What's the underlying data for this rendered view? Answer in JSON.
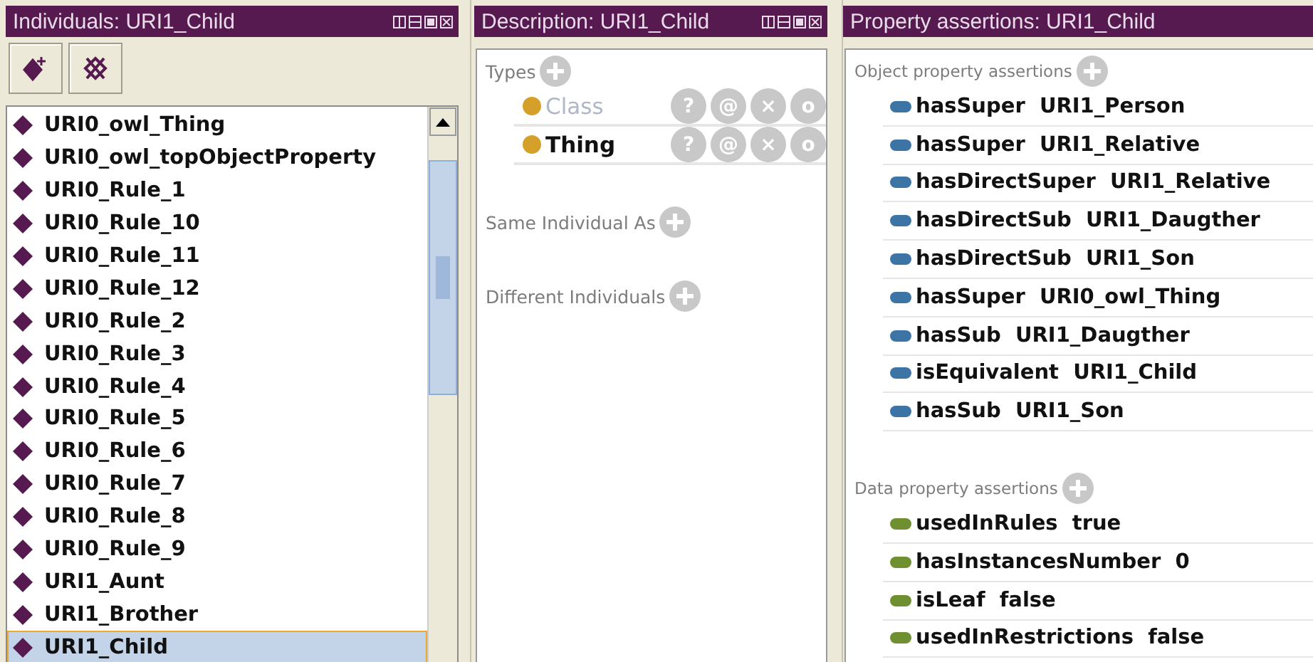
{
  "individuals_panel": {
    "title": "Individuals: URI1_Child",
    "items": [
      {
        "label": "URI0_owl_Thing",
        "selected": false
      },
      {
        "label": "URI0_owl_topObjectProperty",
        "selected": false
      },
      {
        "label": "URI0_Rule_1",
        "selected": false
      },
      {
        "label": "URI0_Rule_10",
        "selected": false
      },
      {
        "label": "URI0_Rule_11",
        "selected": false
      },
      {
        "label": "URI0_Rule_12",
        "selected": false
      },
      {
        "label": "URI0_Rule_2",
        "selected": false
      },
      {
        "label": "URI0_Rule_3",
        "selected": false
      },
      {
        "label": "URI0_Rule_4",
        "selected": false
      },
      {
        "label": "URI0_Rule_5",
        "selected": false
      },
      {
        "label": "URI0_Rule_6",
        "selected": false
      },
      {
        "label": "URI0_Rule_7",
        "selected": false
      },
      {
        "label": "URI0_Rule_8",
        "selected": false
      },
      {
        "label": "URI0_Rule_9",
        "selected": false
      },
      {
        "label": "URI1_Aunt",
        "selected": false
      },
      {
        "label": "URI1_Brother",
        "selected": false
      },
      {
        "label": "URI1_Child",
        "selected": true
      }
    ]
  },
  "description_panel": {
    "title": "Description: URI1_Child",
    "sections": [
      {
        "heading": "Types",
        "items": [
          {
            "label": "Class",
            "disabled": true,
            "actions": [
              "?",
              "@",
              "×",
              "o"
            ]
          },
          {
            "label": "Thing",
            "disabled": false,
            "actions": [
              "?",
              "@",
              "×",
              "o"
            ]
          }
        ]
      },
      {
        "heading": "Same Individual As"
      },
      {
        "heading": "Different Individuals"
      }
    ]
  },
  "property_panel": {
    "title": "Property assertions: URI1_Child",
    "sections": [
      {
        "heading": "Object property assertions",
        "kind": "object",
        "items": [
          {
            "property": "hasSuper",
            "value": "URI1_Person"
          },
          {
            "property": "hasSuper",
            "value": "URI1_Relative"
          },
          {
            "property": "hasDirectSuper",
            "value": "URI1_Relative"
          },
          {
            "property": "hasDirectSub",
            "value": "URI1_Daugther"
          },
          {
            "property": "hasDirectSub",
            "value": "URI1_Son"
          },
          {
            "property": "hasSuper",
            "value": "URI0_owl_Thing"
          },
          {
            "property": "hasSub",
            "value": "URI1_Daugther"
          },
          {
            "property": "isEquivalent",
            "value": "URI1_Child"
          },
          {
            "property": "hasSub",
            "value": "URI1_Son"
          }
        ]
      },
      {
        "heading": "Data property assertions",
        "kind": "data",
        "items": [
          {
            "property": "usedInRules",
            "value": "true"
          },
          {
            "property": "hasInstancesNumber",
            "value": "0"
          },
          {
            "property": "isLeaf",
            "value": "false"
          },
          {
            "property": "usedInRestrictions",
            "value": "false"
          }
        ]
      }
    ]
  }
}
